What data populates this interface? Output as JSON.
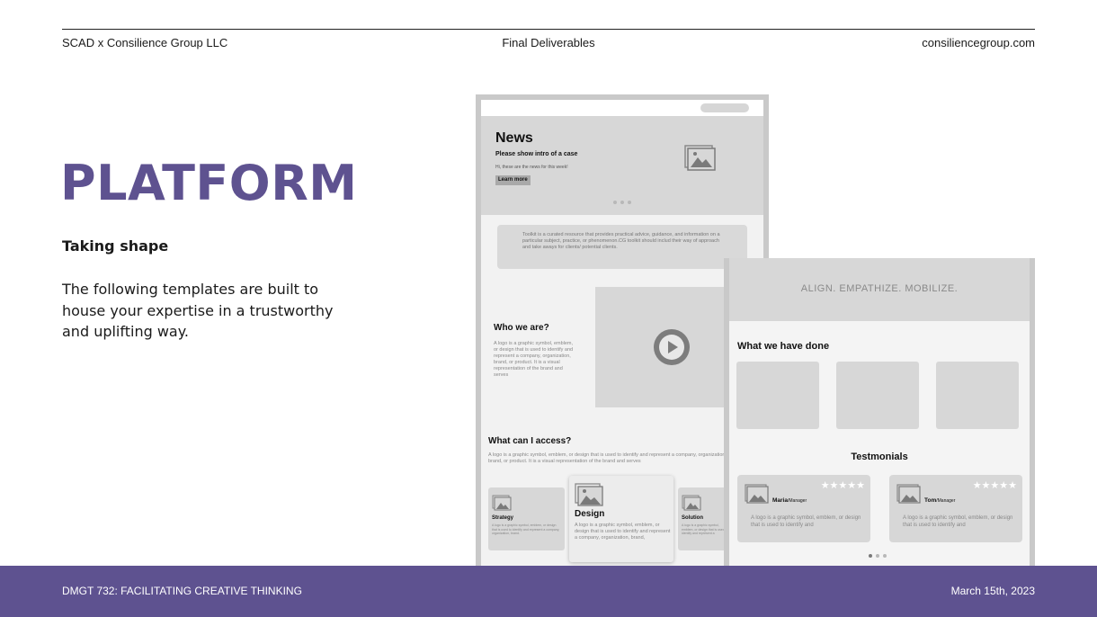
{
  "header": {
    "left": "SCAD x Consilience Group LLC",
    "center": "Final Deliverables",
    "right": "consiliencegroup.com"
  },
  "main": {
    "title": "PLATFORM",
    "subtitle": "Taking shape",
    "body": "The following templates are built to house your expertise in a trustworthy and uplifting way."
  },
  "wireframe_home": {
    "news_title": "News",
    "news_subtitle": "Please show intro of a case",
    "news_small": "Hi, these are the news for this week!",
    "learn_more": "Learn more",
    "toolkit_text": "Toolkit is a curated resource that provides practical advice, guidance, and information on a particular subject, practice, or phenomenon.CG toolkit should includ their way of approach and take aways for clients/ potential clients.",
    "who_title": "Who we are?",
    "who_text": "A logo is a graphic symbol, emblem, or design that is used to identify and represent a company, organization, brand, or product. It is a visual representation of the brand and serves",
    "access_title": "What can I access?",
    "access_text": "A logo is a graphic symbol, emblem, or design that is used to identify and represent a company, organization, brand, or product. It is a visual representation of the brand and serves",
    "cards": [
      {
        "title": "Strategy",
        "text": "A logo is a graphic symbol, emblem, or design that is used to identify and represent a company, organization, brand."
      },
      {
        "title": "Design",
        "text": "A logo is a graphic symbol, emblem, or design that is used to identify and represent a company, organization, brand,"
      },
      {
        "title": "Solution",
        "text": "A logo is a graphic symbol, emblem, or design that is used to identify and represent a company, org"
      }
    ]
  },
  "wireframe_about": {
    "tagline": "ALIGN. EMPATHIZE. MOBILIZE.",
    "done_title": "What we have done",
    "testimonials_title": "Testmonials",
    "testimonials": [
      {
        "name": "Maria",
        "role": "/Manager",
        "text": "A logo is a graphic symbol, emblem, or design that is used to identify and",
        "stars": "★★★★★"
      },
      {
        "name": "Tom",
        "role": "/Manager",
        "text": "A logo is a graphic symbol, emblem, or design that is used to identify and",
        "stars": "★★★★★"
      }
    ]
  },
  "footer": {
    "left": "DMGT 732: FACILITATING CREATIVE THINKING",
    "right": "March 15th, 2023"
  },
  "colors": {
    "brand": "#5e5290",
    "wireframe_gray": "#d7d7d7"
  }
}
